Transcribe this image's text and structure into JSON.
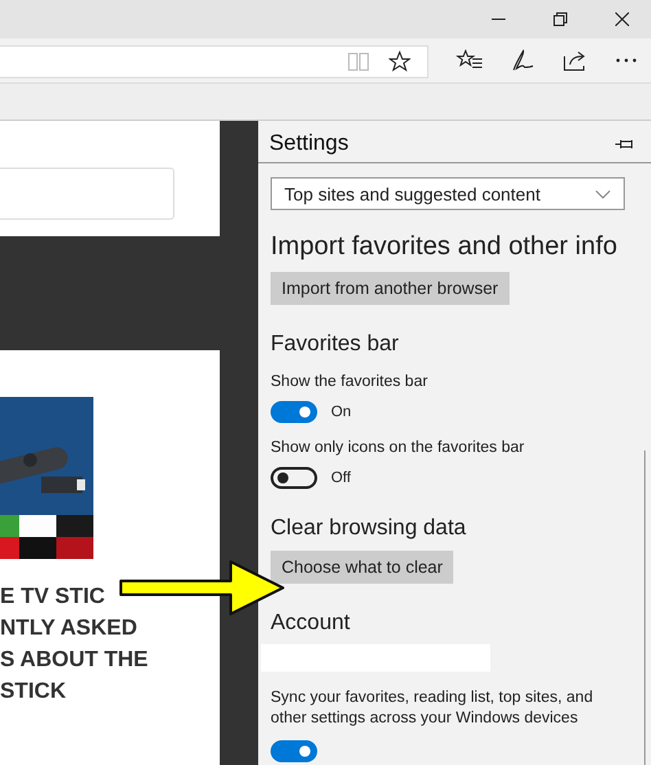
{
  "page": {
    "heading_lines": [
      "E TV STIC",
      "NTLY ASKED",
      "S ABOUT THE",
      "STICK"
    ]
  },
  "settings": {
    "title": "Settings",
    "dropdown": {
      "value": "Top sites and suggested content"
    },
    "items": [
      {
        "kind": "heading",
        "text": "Import favorites and other info"
      },
      {
        "kind": "button",
        "text": "Import from another browser"
      },
      {
        "kind": "subheading",
        "text": "Favorites bar"
      },
      {
        "kind": "label",
        "text": "Show the favorites bar"
      },
      {
        "kind": "toggle",
        "on": true,
        "text": "On"
      },
      {
        "kind": "label",
        "text": "Show only icons on the favorites bar"
      },
      {
        "kind": "toggle",
        "on": false,
        "text": "Off"
      },
      {
        "kind": "subheading",
        "text": "Clear browsing data"
      },
      {
        "kind": "button",
        "text": "Choose what to clear"
      },
      {
        "kind": "subheading",
        "text": "Account"
      },
      {
        "kind": "blank"
      },
      {
        "kind": "paragraph",
        "text": "Sync your favorites, reading list, top sites, and other settings across your Windows devices"
      },
      {
        "kind": "toggle",
        "on": true
      }
    ]
  }
}
